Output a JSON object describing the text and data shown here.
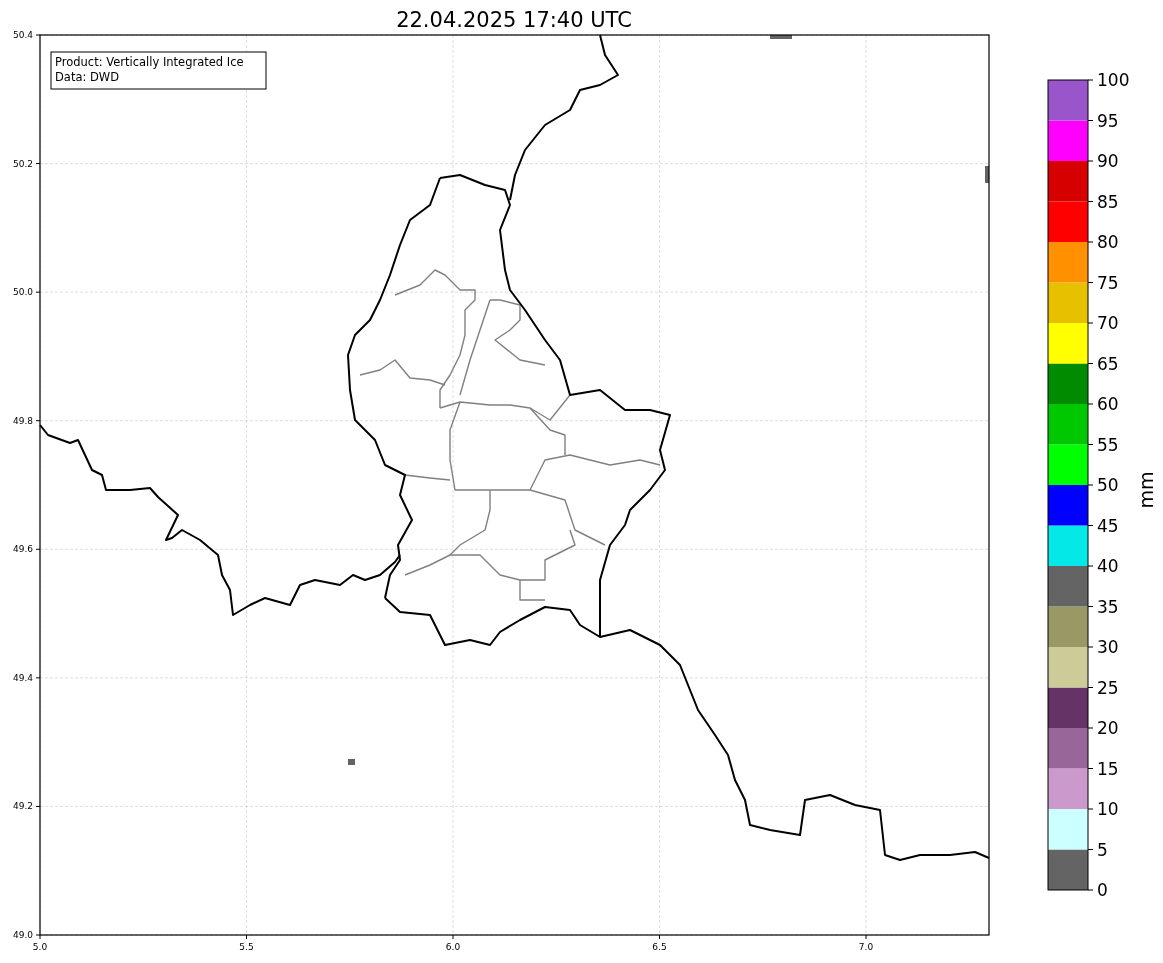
{
  "title": "22.04.2025 17:40 UTC",
  "info_box": {
    "lines": [
      "Product: Vertically Integrated Ice",
      "Data: DWD"
    ]
  },
  "map": {
    "x_ticks": [
      "5.0",
      "5.5",
      "6.0",
      "6.5",
      "7.0"
    ],
    "y_ticks": [
      "50.4",
      "50.2",
      "50.0",
      "49.8",
      "49.6",
      "49.4",
      "49.2",
      "49.0"
    ]
  },
  "colorbar": {
    "label": "mm",
    "ticks": [
      "100",
      "95",
      "90",
      "85",
      "80",
      "75",
      "70",
      "65",
      "60",
      "55",
      "50",
      "45",
      "40",
      "35",
      "30",
      "25",
      "20",
      "15",
      "10",
      "5",
      "0"
    ],
    "bins": [
      {
        "color": "#646464"
      },
      {
        "color": "#ccffff"
      },
      {
        "color": "#cc99cc"
      },
      {
        "color": "#996699"
      },
      {
        "color": "#663366"
      },
      {
        "color": "#cccc99"
      },
      {
        "color": "#999966"
      },
      {
        "color": "#646464"
      },
      {
        "color": "#04e9e7"
      },
      {
        "color": "#0000ff"
      },
      {
        "color": "#00ff00"
      },
      {
        "color": "#00c800"
      },
      {
        "color": "#008c00"
      },
      {
        "color": "#ffff00"
      },
      {
        "color": "#e7c000"
      },
      {
        "color": "#ff9000"
      },
      {
        "color": "#ff0000"
      },
      {
        "color": "#d60000"
      },
      {
        "color": "#ff00ff"
      },
      {
        "color": "#9955c9"
      }
    ]
  }
}
